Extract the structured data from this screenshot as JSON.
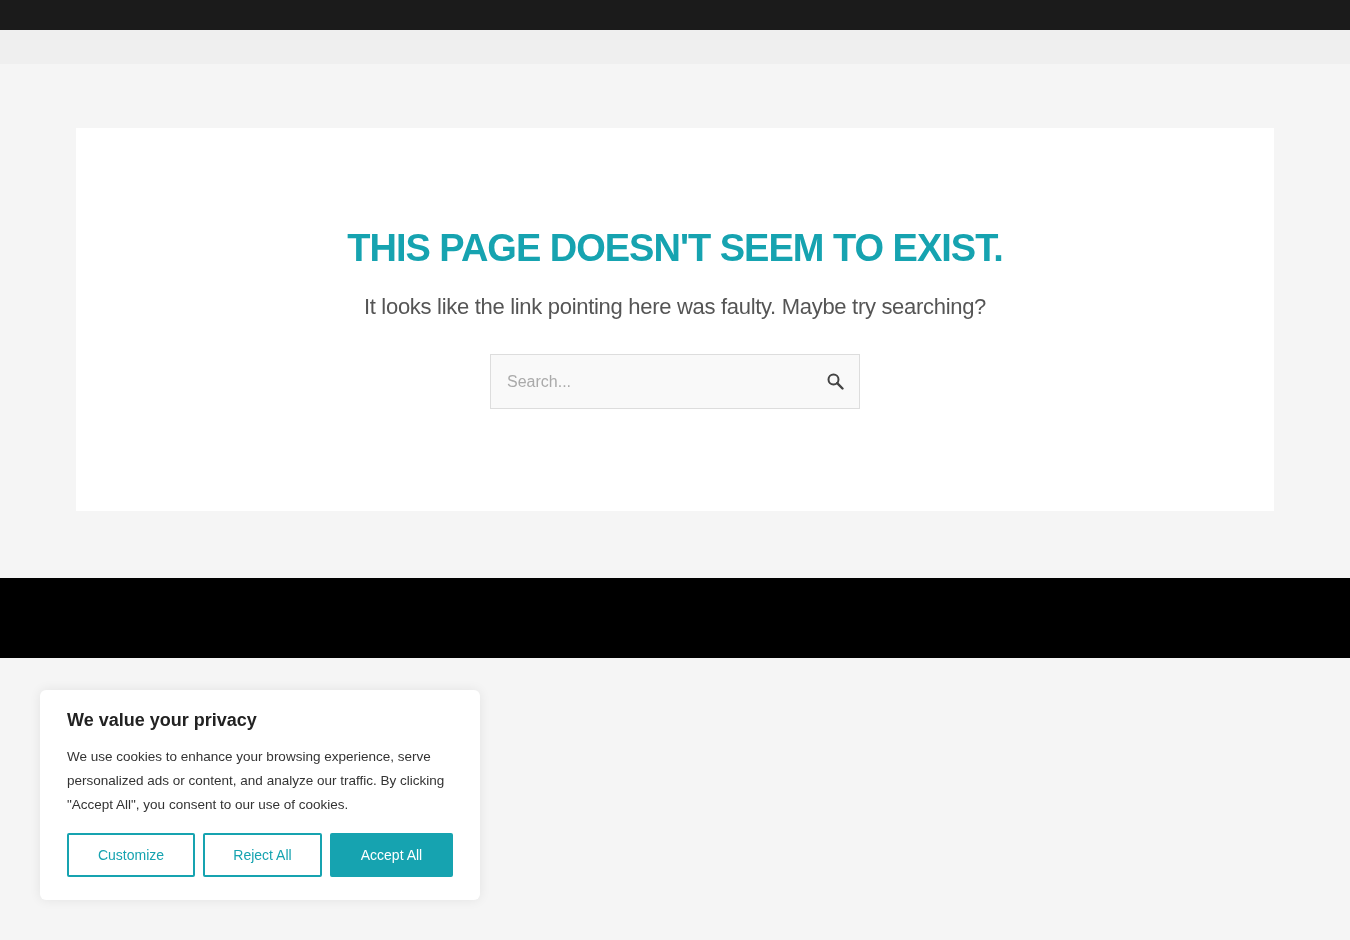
{
  "error": {
    "heading": "THIS PAGE DOESN'T SEEM TO EXIST.",
    "message": "It looks like the link pointing here was faulty. Maybe try searching?"
  },
  "search": {
    "placeholder": "Search..."
  },
  "cookie_banner": {
    "title": "We value your privacy",
    "text": "We use cookies to enhance your browsing experience, serve personalized ads or content, and analyze our traffic. By clicking \"Accept All\", you consent to our use of cookies.",
    "buttons": [
      {
        "label": "Customize",
        "kind": "outline"
      },
      {
        "label": "Reject All",
        "kind": "outline"
      },
      {
        "label": "Accept All",
        "kind": "primary"
      }
    ]
  }
}
